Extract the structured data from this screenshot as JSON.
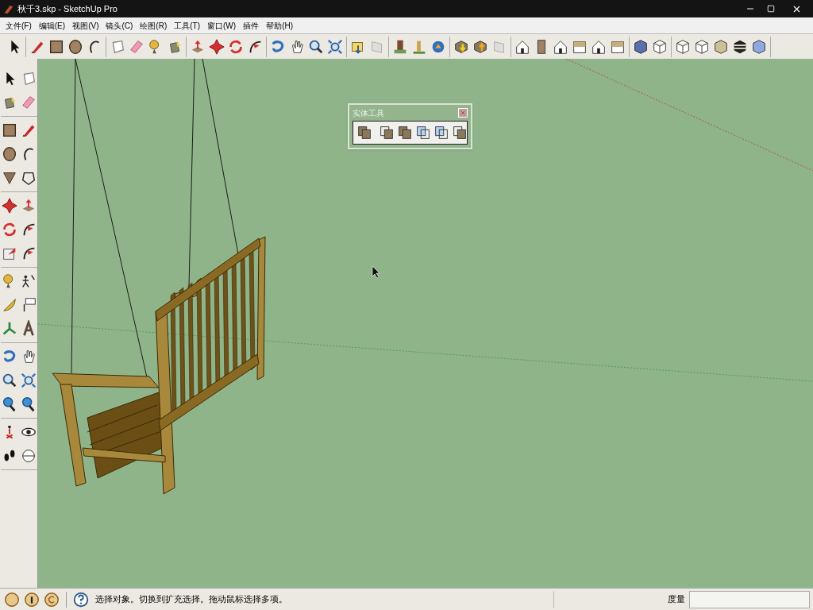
{
  "window": {
    "title": "秋千3.skp - SketchUp Pro"
  },
  "menu": [
    "文件(F)",
    "编辑(E)",
    "视图(V)",
    "镜头(C)",
    "绘图(R)",
    "工具(T)",
    "窗口(W)",
    "插件",
    "帮助(H)"
  ],
  "solid_tools_panel": {
    "title": "实体工具"
  },
  "status_bar": {
    "message": "选择对象。切换到扩充选择。拖动鼠标选择多项。",
    "measurement_label": "度量"
  }
}
